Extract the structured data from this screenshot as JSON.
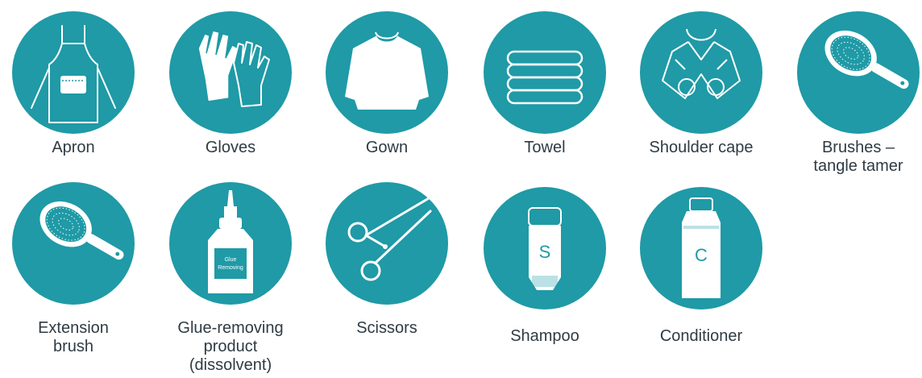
{
  "theme": {
    "circle_color": "#1f9aa6",
    "text_color": "#2f3b43"
  },
  "items": [
    {
      "icon": "apron-icon",
      "label": "Apron"
    },
    {
      "icon": "gloves-icon",
      "label": "Gloves"
    },
    {
      "icon": "gown-icon",
      "label": "Gown"
    },
    {
      "icon": "towel-icon",
      "label": "Towel"
    },
    {
      "icon": "shoulder-cape-icon",
      "label": "Shoulder cape"
    },
    {
      "icon": "brush-icon",
      "label": "Brushes –\ntangle tamer"
    },
    {
      "icon": "brush-icon",
      "label": "Extension\nbrush"
    },
    {
      "icon": "glue-bottle-icon",
      "label": "Glue-removing\nproduct\n(dissolvent)",
      "bottle_text": "Glue\nRemoving"
    },
    {
      "icon": "scissors-icon",
      "label": "Scissors"
    },
    {
      "icon": "shampoo-icon",
      "label": "Shampoo",
      "bottle_letter": "S"
    },
    {
      "icon": "conditioner-icon",
      "label": "Conditioner",
      "bottle_letter": "C"
    }
  ]
}
